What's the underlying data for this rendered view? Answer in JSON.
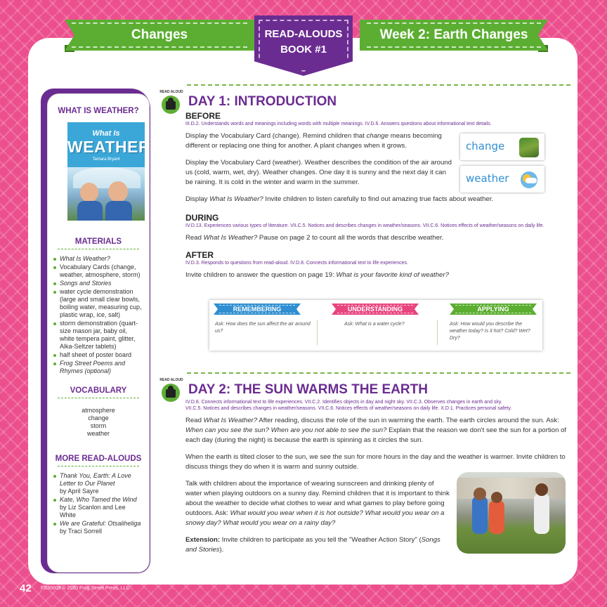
{
  "header": {
    "left_banner": "Changes",
    "center_line1": "READ-ALOUDS",
    "center_line2": "BOOK #1",
    "right_banner": "Week 2: Earth Changes"
  },
  "sidebar": {
    "what_is_heading": "WHAT IS WEATHER?",
    "cover": {
      "small": "What Is",
      "big": "WEATHER?",
      "author": "Tamara Bryant"
    },
    "materials_heading": "MATERIALS",
    "materials": [
      {
        "text": "What Is Weather?",
        "italic": true
      },
      {
        "text": "Vocabulary Cards (change, weather, atmosphere, storm)",
        "italic": false
      },
      {
        "text": "Songs and Stories",
        "italic": true
      },
      {
        "text": "water cycle demonstration (large and small clear bowls, boiling water, measuring cup, plastic wrap, ice, salt)",
        "italic": false
      },
      {
        "text": "storm demonstration (quart-size mason jar, baby oil, white tempera paint, glitter, Alka-Seltzer tablets)",
        "italic": false
      },
      {
        "text": "half sheet of poster board",
        "italic": false
      },
      {
        "text": "Frog Street Poems and Rhymes (optional)",
        "italic": true
      }
    ],
    "vocabulary_heading": "VOCABULARY",
    "vocabulary": [
      "atmosphere",
      "change",
      "storm",
      "weather"
    ],
    "more_heading": "MORE READ-ALOUDS",
    "more": [
      {
        "title": "Thank You, Earth: A Love Letter to Our Planet",
        "author": "by April Sayre"
      },
      {
        "title": "Kate, Who Tamed the Wind",
        "author": "by Liz Scanlon and Lee White"
      },
      {
        "title": "We are Grateful: Otsaliheliga",
        "author": "by Traci Sorrell"
      }
    ]
  },
  "badge_text": "READ ALOUD",
  "day1": {
    "title": "DAY 1: INTRODUCTION",
    "before_heading": "BEFORE",
    "before_std": "III.D.2. Understands words and meanings including words with multiple meanings. IV.D.6. Answers questions about informational text details.",
    "p1_a": "Display the Vocabulary Card (change). Remind children that ",
    "p1_em": "change",
    "p1_b": " means becoming different or replacing one thing for another. A plant changes when it grows.",
    "p2": "Display the Vocabulary Card (weather). Weather describes the condition of the air around us (cold, warm, wet, dry). Weather changes. One day it is sunny and the next day it can be raining. It is cold in the winter and warm in the summer.",
    "p3_a": "Display ",
    "p3_em": "What Is Weather?",
    "p3_b": " Invite children to listen carefully to find out amazing true facts about weather.",
    "card1": "change",
    "card2": "weather",
    "during_heading": "DURING",
    "during_std": "IV.D.13. Experiences various types of literature. VII.C.5. Notices and describes changes in weather/seasons. VII.C.6. Notices effects of weather/seasons on daily life.",
    "p4_a": "Read ",
    "p4_em": "What Is Weather?",
    "p4_b": " Pause on page 2 to count all the words that describe weather.",
    "after_heading": "AFTER",
    "after_std": "IV.D.3. Responds to questions from read-aloud. IV.D.8. Connects informational text to life experiences.",
    "p5_a": "Invite children to answer the question on page 19: ",
    "p5_em": "What is your favorite kind of weather?",
    "bloom": [
      {
        "tag": "REMEMBERING",
        "color": "#2f8fd1",
        "q": "Ask: How does the sun affect the air around us?"
      },
      {
        "tag": "UNDERSTANDING",
        "color": "#e8457f",
        "q": "Ask: What is a water cycle?"
      },
      {
        "tag": "APPLYING",
        "color": "#5cae32",
        "q": "Ask: How would you describe the weather today? Is it hot? Cold? Wet? Dry?"
      }
    ]
  },
  "day2": {
    "title": "DAY 2: THE SUN WARMS THE EARTH",
    "std1": "IV.D.8. Connects informational text to life experiences. VII.C.2. Identifies objects in day and night sky. VII.C.3. Observes changes in earth and sky.",
    "std2": "VII.C.5. Notices and describes changes in weather/seasons. VII.C.6. Notices effects of weather/seasons on daily life. X.D.1. Practices personal safety.",
    "p1_a": "Read ",
    "p1_em1": "What Is Weather?",
    "p1_b": " After reading, discuss the role of the sun in warming the earth. The earth circles around the sun. Ask: ",
    "p1_em2": "When can you see the sun? When are you not able to see the sun?",
    "p1_c": " Explain that the reason we don't see the sun for a portion of each day (during the night) is because the earth is spinning as it circles the sun.",
    "p2": "When the earth is tilted closer to the sun, we see the sun for more hours in the day and the weather is warmer. Invite children to discuss things they do when it is warm and sunny outside.",
    "p3_a": "Talk with children about the importance of wearing sunscreen and drinking plenty of water when playing outdoors on a sunny day. Remind children that it is important to think about the weather to decide what clothes to wear and what games to play before going outdoors. Ask: ",
    "p3_em": "What would you wear when it is hot outside? What would you wear on a snowy day? What would you wear on a rainy day?",
    "ext_label": "Extension:",
    "ext_a": " Invite children to participate as you tell the \"Weather Action Story\" (",
    "ext_em": "Songs and Stories",
    "ext_b": ")."
  },
  "footer": {
    "page_number": "42",
    "copyright": "FS30009 © 2020 Frog Street Press, LLC"
  }
}
